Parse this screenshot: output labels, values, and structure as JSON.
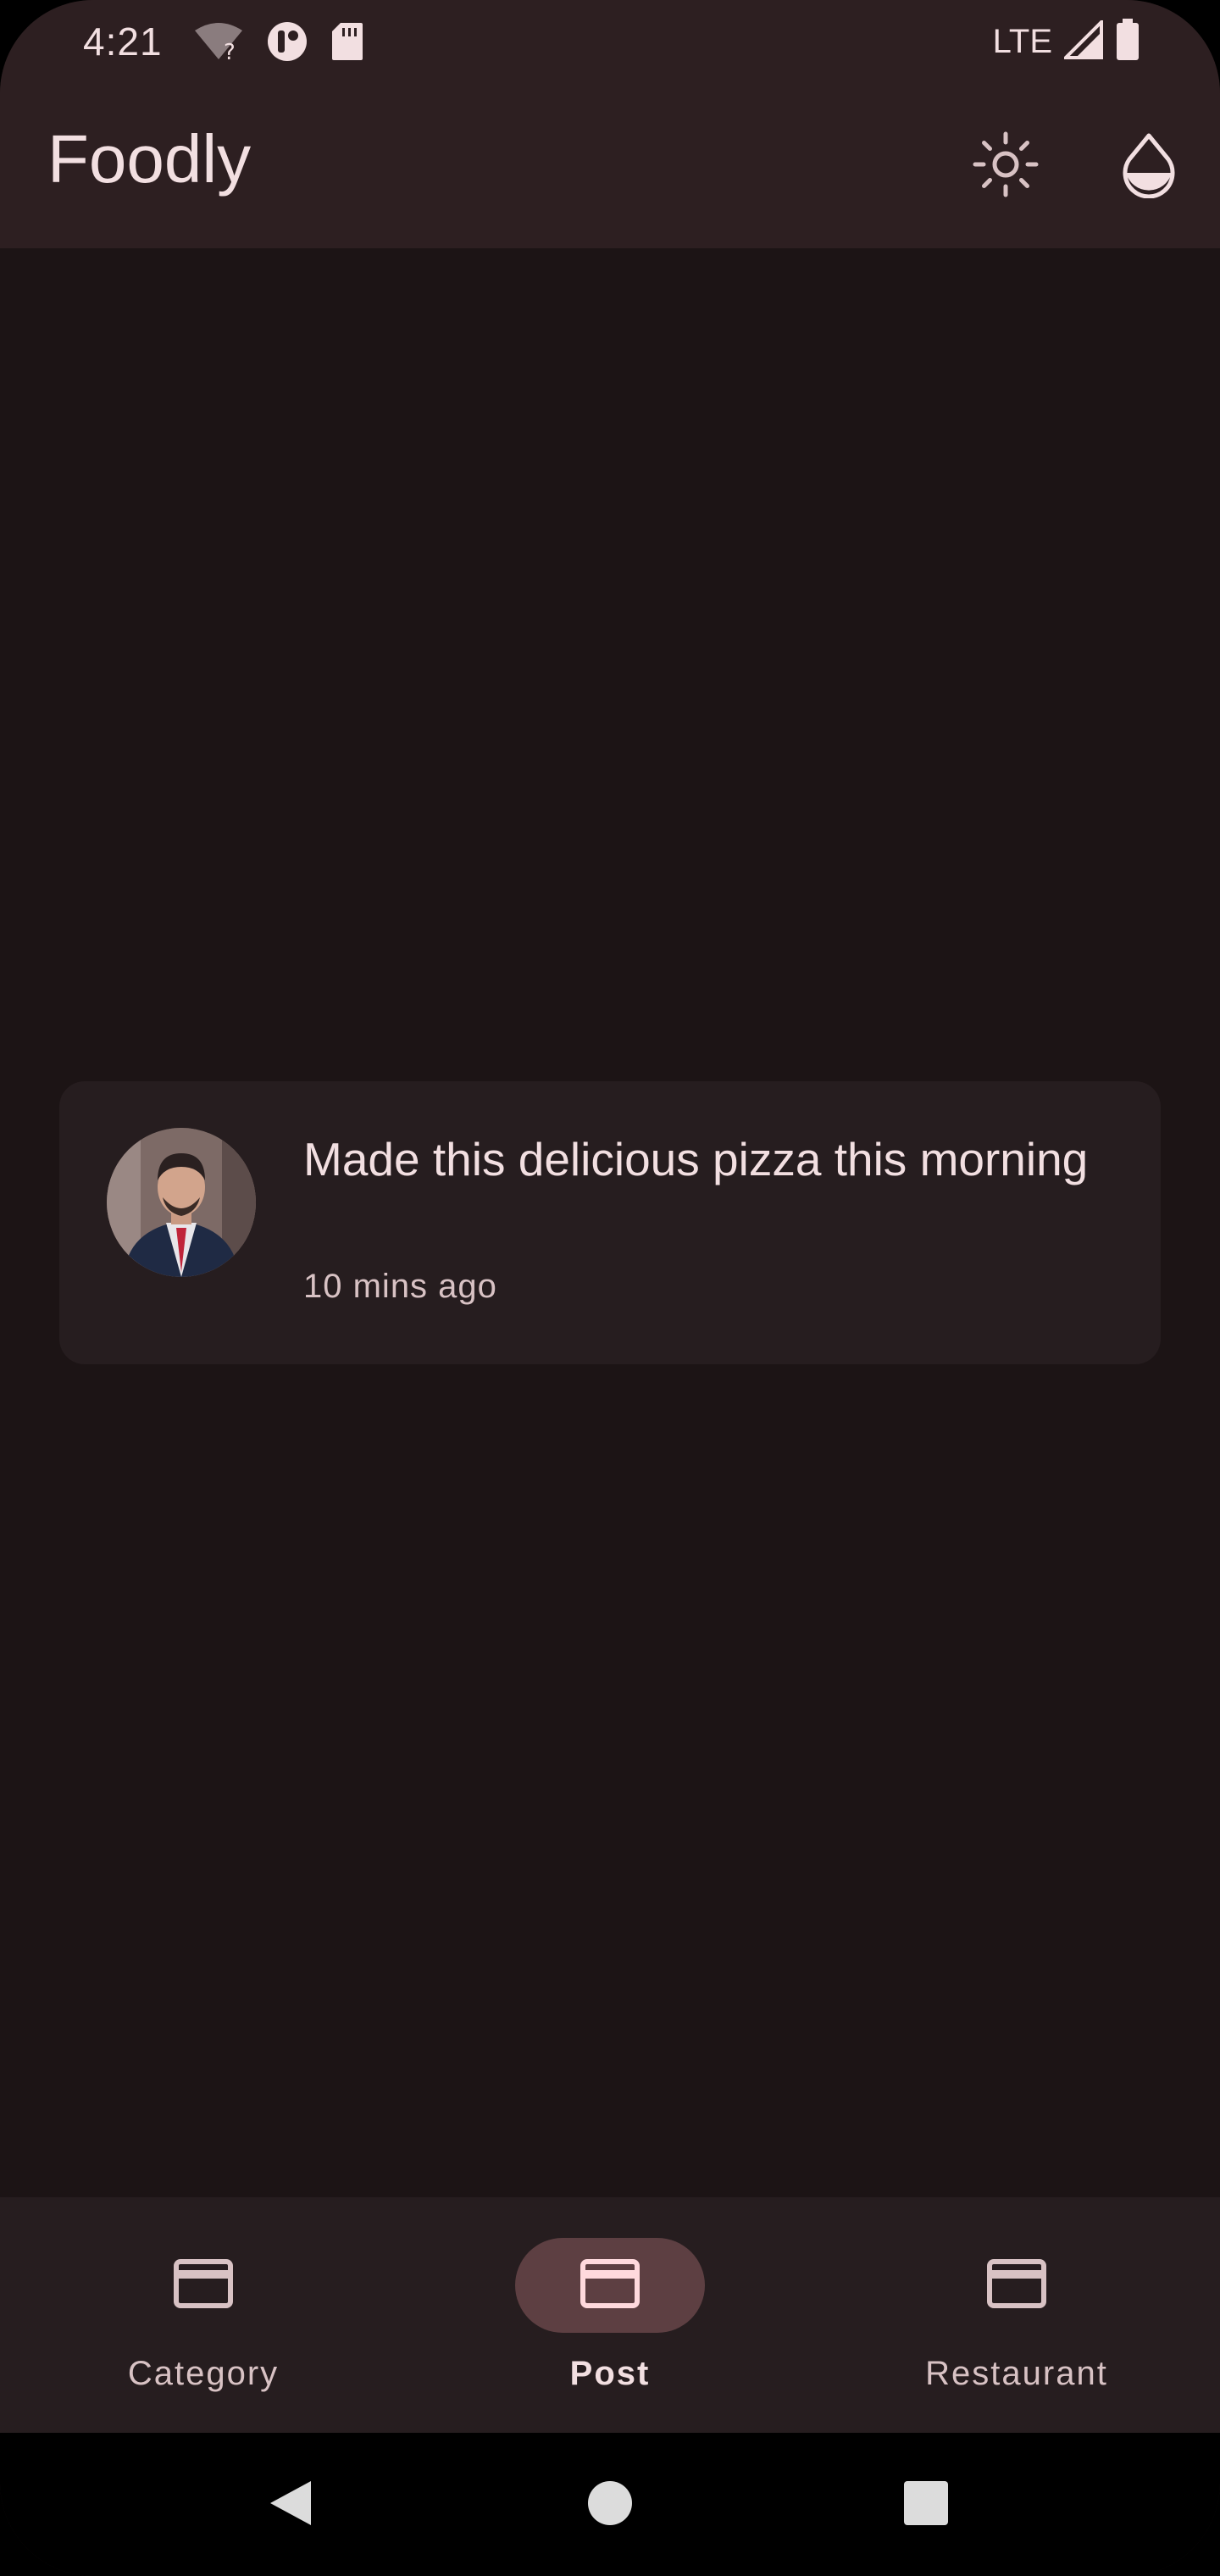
{
  "status_bar": {
    "time": "4:21",
    "network": "LTE",
    "icons": [
      "wifi-question-icon",
      "data-saver-icon",
      "sd-card-icon",
      "signal-icon",
      "battery-icon"
    ]
  },
  "app_bar": {
    "title": "Foodly",
    "actions": [
      "brightness-icon",
      "color-drop-icon"
    ]
  },
  "post": {
    "text": "Made this delicious pizza this morning",
    "time": "10 mins ago",
    "avatar": "user-avatar"
  },
  "bottom_nav": {
    "items": [
      {
        "label": "Category",
        "icon": "card-icon",
        "active": false
      },
      {
        "label": "Post",
        "icon": "card-icon",
        "active": true
      },
      {
        "label": "Restaurant",
        "icon": "card-icon",
        "active": false
      }
    ]
  },
  "system_nav": [
    "back-icon",
    "home-icon",
    "recents-icon"
  ],
  "colors": {
    "background": "#1c1415",
    "app_bar": "#2d1f21",
    "card": "#261d1f",
    "nav_indicator": "#5d3f42",
    "on_surface": "#f2dfe1",
    "on_surface_variant": "#d8c2c4"
  }
}
